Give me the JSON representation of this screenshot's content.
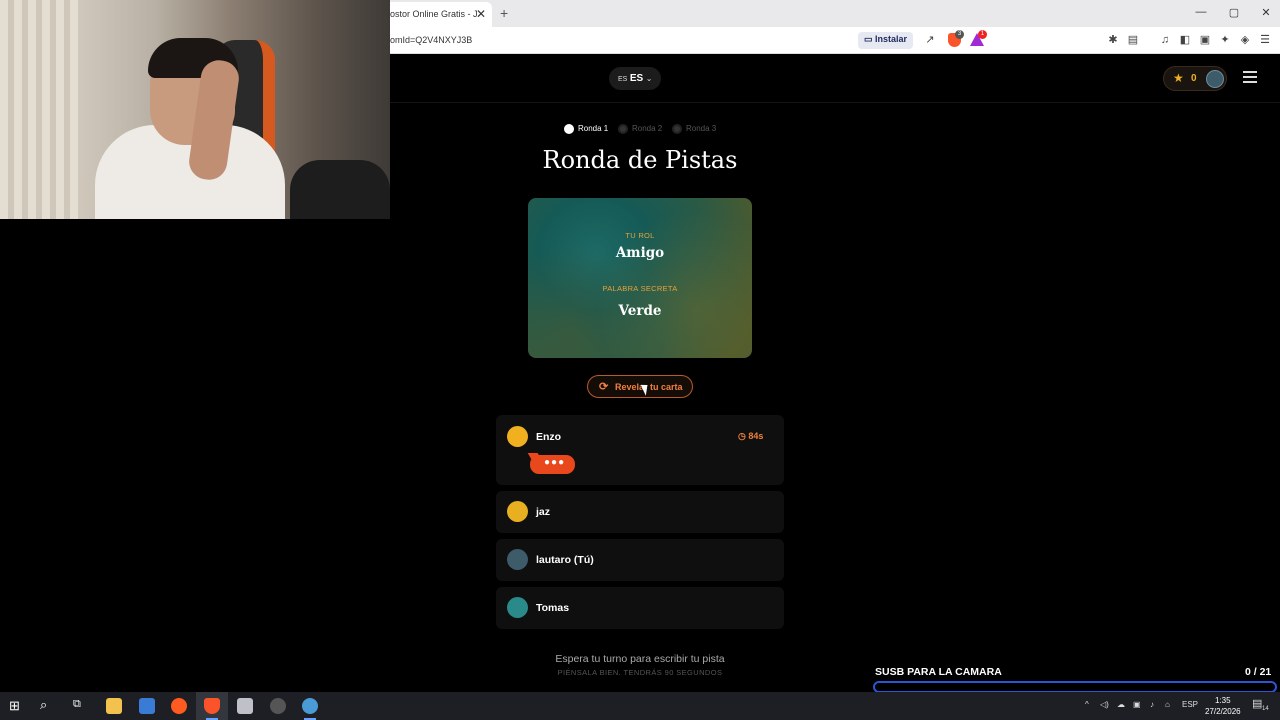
{
  "browser": {
    "tab_title": "ostor Online Gratis - J",
    "tab_close": "✕",
    "new_tab": "+",
    "url": "omId=Q2V4NXYJ3B",
    "install_label": "Instalar",
    "brave_badge": "3",
    "rewards_badge": "1",
    "window_controls": [
      "—",
      "▢",
      "✕"
    ]
  },
  "header": {
    "lang_small": "ES",
    "lang_big": "ES",
    "points": "0"
  },
  "rounds": [
    {
      "label": "Ronda 1",
      "active": true
    },
    {
      "label": "Ronda 2",
      "active": false
    },
    {
      "label": "Ronda 3",
      "active": false
    }
  ],
  "title": "Ronda de Pistas",
  "card": {
    "role_label": "TU ROL",
    "role_value": "Amigo",
    "word_label": "PALABRA SECRETA",
    "word_value": "Verde"
  },
  "reveal_button": "Revelar tu carta",
  "players": [
    {
      "name": "Enzo",
      "timer": "84s",
      "avatar_color": "#f0b020"
    },
    {
      "name": "jaz",
      "avatar_color": "#e8b020"
    },
    {
      "name": "lautaro (Tú)",
      "avatar_color": "#3e5b6a"
    },
    {
      "name": "Tomas",
      "avatar_color": "#2a8a8a"
    }
  ],
  "wait": {
    "main": "Espera tu turno para escribir tu pista",
    "sub": "PIÉNSALA BIEN. TENDRÁS 90 SEGUNDOS"
  },
  "overlay": {
    "label": "SUSB PARA LA CAMARA",
    "count": "0   / 21",
    "progress": 0
  },
  "taskbar": {
    "lang": "ESP",
    "time": "1:35",
    "date": "27/2/2026",
    "notifications": "14"
  }
}
